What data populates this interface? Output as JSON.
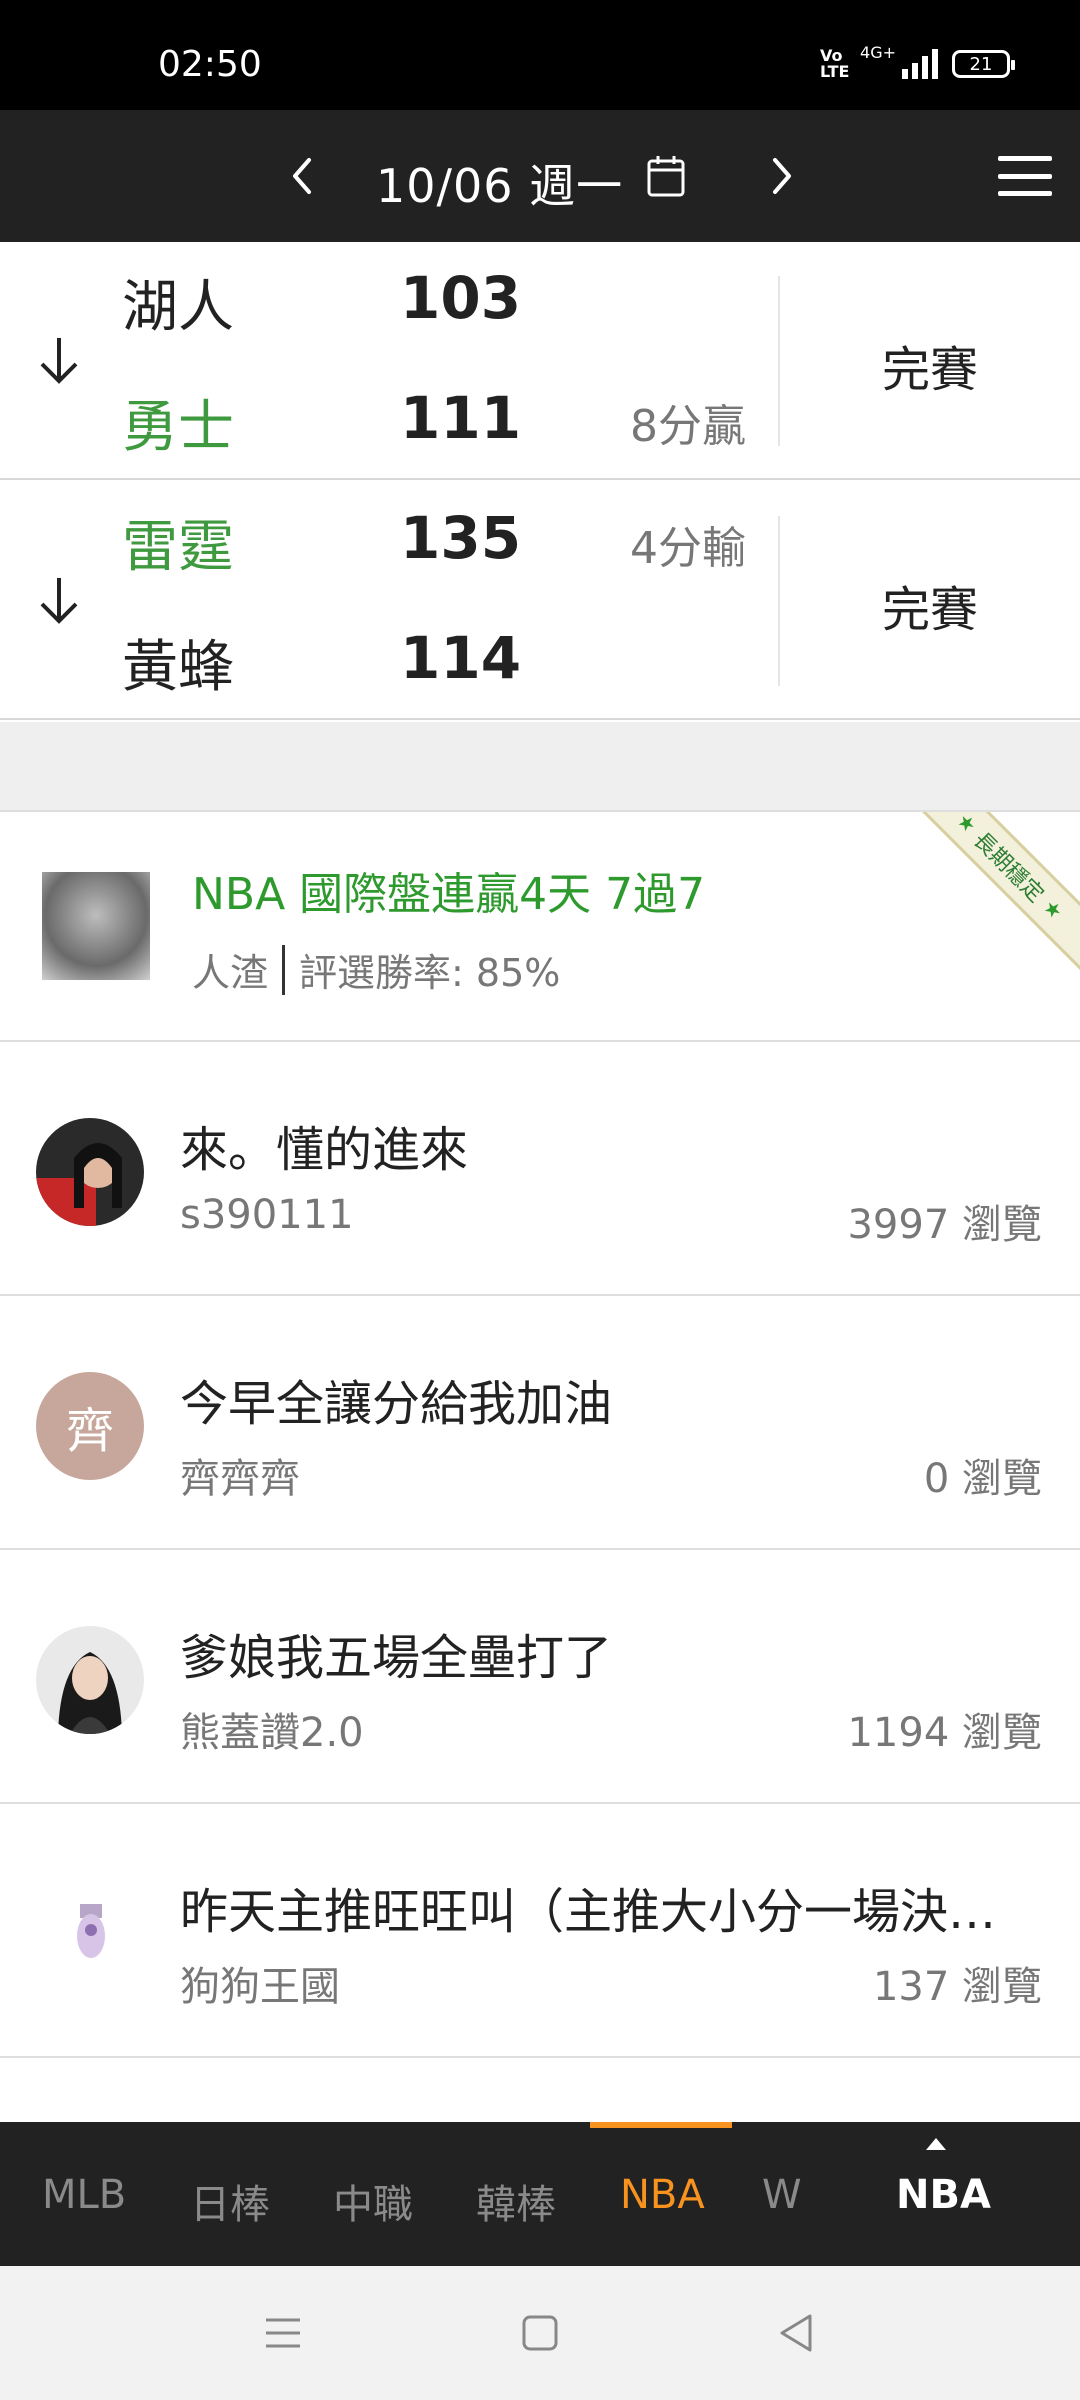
{
  "status_bar": {
    "time": "02:50",
    "network": "4G+",
    "volte": "Vo LTE",
    "battery": "21"
  },
  "date_bar": {
    "date": "10/06 週一"
  },
  "games": [
    {
      "team1": "湖人",
      "score1": "103",
      "team2": "勇士",
      "score2": "111",
      "winner": 2,
      "result": "8分贏",
      "result_row": 2,
      "status": "完賽"
    },
    {
      "team1": "雷霆",
      "score1": "135",
      "team2": "黃蜂",
      "score2": "114",
      "winner": 1,
      "result": "4分輸",
      "result_row": 1,
      "status": "完賽"
    }
  ],
  "featured": {
    "title": "NBA 國際盤連贏4天 7過7",
    "author": "人渣",
    "win_rate": "評選勝率: 85%",
    "ribbon": "長期穩定"
  },
  "posts": [
    {
      "title": "來。懂的進來",
      "author": "s390111",
      "views": "3997 瀏覽"
    },
    {
      "title": "今早全讓分給我加油",
      "author": "齊齊齊",
      "views": "0 瀏覽",
      "avatar_text": "齊"
    },
    {
      "title": "爹娘我五場全壘打了",
      "author": "熊蓋讚2.0",
      "views": "1194 瀏覽"
    },
    {
      "title": "昨天主推旺旺叫（主推大小分一場決勝負）",
      "author": "狗狗王國",
      "views": "137 瀏覽"
    }
  ],
  "tabs": [
    {
      "label": "MLB"
    },
    {
      "label": "日棒"
    },
    {
      "label": "中職"
    },
    {
      "label": "韓棒"
    },
    {
      "label": "NBA"
    },
    {
      "label": "W"
    }
  ],
  "active_tab": "NBA",
  "league_selector": "NBA",
  "colors": {
    "win_green": "#3f9a3f",
    "accent_orange": "#f7931e",
    "header_bg": "#222222"
  }
}
